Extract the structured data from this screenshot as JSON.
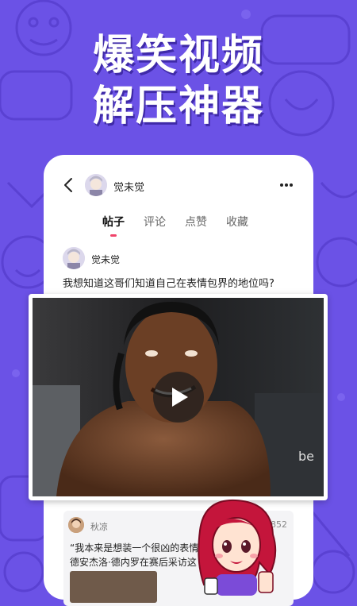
{
  "promo": {
    "headline_line1": "爆笑视频",
    "headline_line2": "解压神器"
  },
  "profile": {
    "username": "觉未觉",
    "tabs": [
      {
        "label": "帖子",
        "active": true
      },
      {
        "label": "评论",
        "active": false
      },
      {
        "label": "点赞",
        "active": false
      },
      {
        "label": "收藏",
        "active": false
      }
    ]
  },
  "post": {
    "author": "觉未觉",
    "text": "我想知道这哥们知道自己在表情包界的地位吗?"
  },
  "card": {
    "author": "秋凉",
    "views": "1852",
    "quote": "“我本来是想装一个很凶的表情”",
    "subtitle": "德安杰洛·德内罗在赛后采访这"
  },
  "icons": {
    "back": "chevron-left-icon",
    "more": "more-horizontal-icon",
    "play": "play-icon"
  },
  "colors": {
    "background": "#6b52e6",
    "accent_underline": "#f0446a"
  }
}
